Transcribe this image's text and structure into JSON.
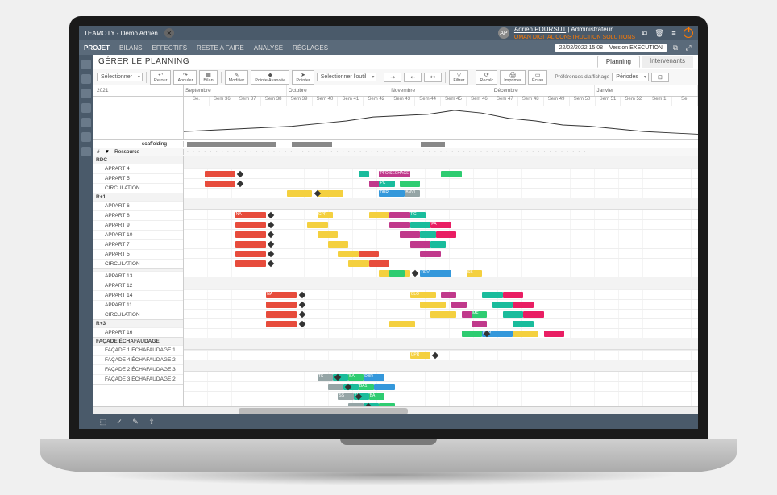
{
  "titlebar": {
    "title": "TEAMOTY - Démo Adrien",
    "avatar": "AP",
    "user": "Adrien POURSUT",
    "role": "Administrateur",
    "subbrand": "OMAN DIGITAL CONSTRUCTION SOLUTIONS"
  },
  "menubar": {
    "items": [
      "PROJET",
      "BILANS",
      "EFFECTIFS",
      "RESTE A FAIRE",
      "ANALYSE",
      "RÉGLAGES"
    ],
    "version_box": "22/02/2022 15:08 – Version EXECUTION"
  },
  "page": {
    "title": "GÉRER LE PLANNING",
    "tabs": [
      "Planning",
      "Intervenants"
    ]
  },
  "toolbar": {
    "selection": "Sélectionner",
    "retour": "Retour",
    "annuler": "Annuler",
    "bilan": "Bilan",
    "modifier": "Modifier",
    "pointe_avancee": "Pointe Avancée",
    "pointer": "Pointer",
    "select_tool": "Sélectionner l'outil",
    "fitrer": "Filtrer",
    "recalc": "Recalc",
    "imprimer": "Imprimer",
    "ecran": "Écran",
    "pref": "Préférences d'affichage",
    "periodes": "Périodes"
  },
  "timeline": {
    "year_left": "2021",
    "months": [
      "Septembre",
      "Octobre",
      "Novembre",
      "Décembre",
      "Janvier"
    ],
    "weeks": [
      "Se.",
      "Sem 36",
      "Sem 37",
      "Sem 38",
      "Sem 39",
      "Sem 40",
      "Sem 41",
      "Sem 42",
      "Sem 43",
      "Sem 44",
      "Sem 45",
      "Sem 46",
      "Sem 47",
      "Sem 48",
      "Sem 49",
      "Sem 50",
      "Sem 51",
      "Sem 52",
      "Sem 1",
      "Se."
    ]
  },
  "scaffold_row": "scaffolding",
  "left_cols": {
    "col1": "#",
    "col2": "Ressource"
  },
  "groups": [
    {
      "head": "RDC",
      "rows": [
        "APPART 4",
        "APPART 5",
        "CIRCULATION"
      ]
    },
    {
      "head": "R+1",
      "rows": [
        "APPART 6",
        "APPART 8",
        "APPART 9",
        "APPART 10",
        "APPART 7",
        "APPART 5",
        "CIRCULATION"
      ]
    },
    {
      "head": "",
      "rows": [
        "APPART 13",
        "APPART 12",
        "APPART 14",
        "APPART 11",
        "CIRCULATION"
      ]
    },
    {
      "head": "R+3",
      "rows": [
        "APPART 16"
      ]
    },
    {
      "head": "FAÇADE ÉCHAFAUDAGE",
      "rows": [
        "FAÇADE 1     ÉCHAFAUDAGE 1",
        "FAÇADE 4     ÉCHAFAUDAGE 2",
        "FAÇADE 2     ÉCHAFAUDAGE 3",
        "FAÇADE 3     ÉCHAFAUDAGE 2"
      ]
    }
  ],
  "bars_palette": {
    "red": "#e74c3c",
    "yellow": "#f4d03f",
    "blue": "#3498db",
    "cyan": "#1abc9c",
    "pink": "#e91e63",
    "green": "#2ecc71",
    "orange": "#e67e22",
    "magenta": "#c0398b",
    "grey": "#95a5a6",
    "brown": "#8d6e63"
  },
  "bar_labels": {
    "na": "NA",
    "pc": "PC",
    "cpr": "CPR",
    "clo": "CLO",
    "rev": "REV",
    "ss": "SS",
    "ts": "TS",
    "ba": "BA",
    "ba1": "BA1",
    "dbr": "DBR",
    "bnvl": "BNVL",
    "sechage": "PFO SECHAGE",
    "pa": "PA",
    "me": "ME"
  },
  "chart_data": {
    "type": "line",
    "title": "",
    "x": [
      "Se.",
      "36",
      "37",
      "38",
      "39",
      "40",
      "41",
      "42",
      "43",
      "44",
      "45",
      "46",
      "47",
      "48",
      "49",
      "50",
      "51",
      "52",
      "1",
      "Se."
    ],
    "values": [
      12,
      14,
      16,
      18,
      20,
      24,
      28,
      34,
      36,
      38,
      44,
      40,
      32,
      28,
      22,
      20,
      16,
      12,
      10,
      8
    ],
    "ylim": [
      0,
      50
    ]
  }
}
